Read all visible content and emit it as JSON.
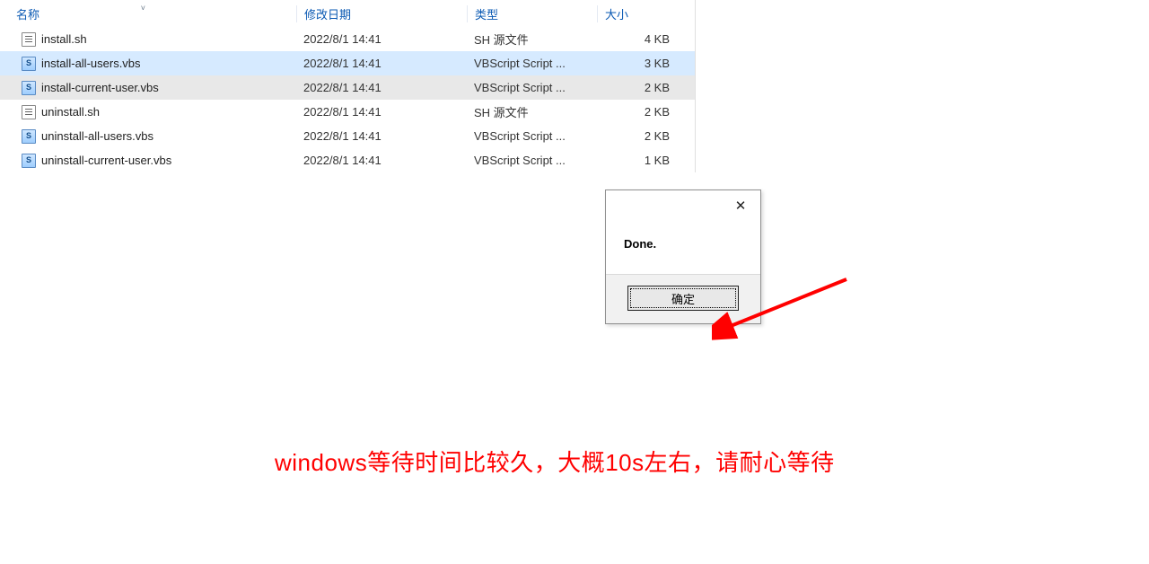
{
  "columns": {
    "name": "名称",
    "date": "修改日期",
    "type": "类型",
    "size": "大小"
  },
  "files": [
    {
      "icon": "sh",
      "name": "install.sh",
      "date": "2022/8/1 14:41",
      "type": "SH 源文件",
      "size": "4 KB",
      "state": ""
    },
    {
      "icon": "vbs",
      "name": "install-all-users.vbs",
      "date": "2022/8/1 14:41",
      "type": "VBScript Script ...",
      "size": "3 KB",
      "state": "selected"
    },
    {
      "icon": "vbs",
      "name": "install-current-user.vbs",
      "date": "2022/8/1 14:41",
      "type": "VBScript Script ...",
      "size": "2 KB",
      "state": "hover"
    },
    {
      "icon": "sh",
      "name": "uninstall.sh",
      "date": "2022/8/1 14:41",
      "type": "SH 源文件",
      "size": "2 KB",
      "state": ""
    },
    {
      "icon": "vbs",
      "name": "uninstall-all-users.vbs",
      "date": "2022/8/1 14:41",
      "type": "VBScript Script ...",
      "size": "2 KB",
      "state": ""
    },
    {
      "icon": "vbs",
      "name": "uninstall-current-user.vbs",
      "date": "2022/8/1 14:41",
      "type": "VBScript Script ...",
      "size": "1 KB",
      "state": ""
    }
  ],
  "dialog": {
    "message": "Done.",
    "ok": "确定"
  },
  "caption": "windows等待时间比较久，大概10s左右，请耐心等待"
}
